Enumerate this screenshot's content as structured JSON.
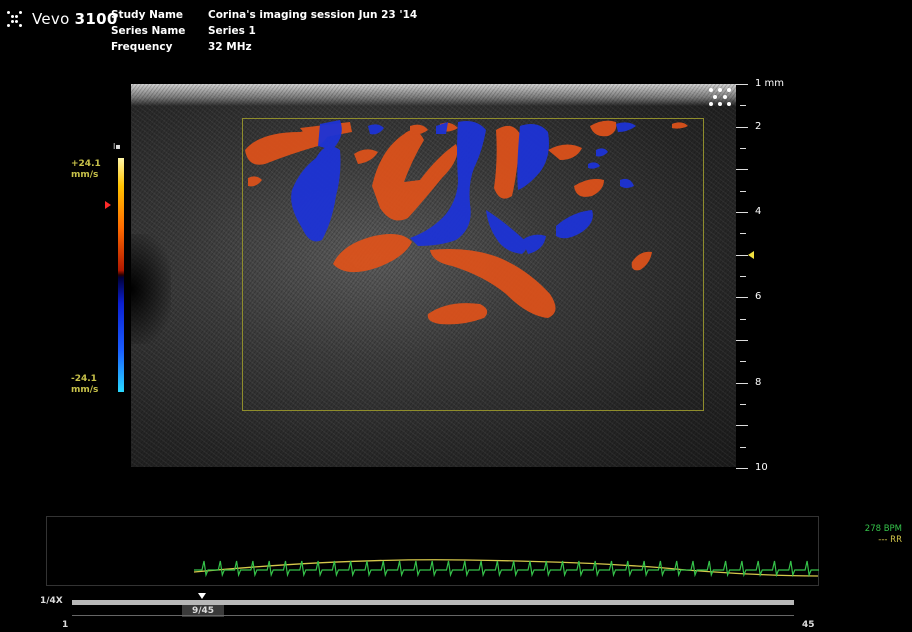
{
  "app": {
    "brand": "Vevo",
    "model": "3100"
  },
  "study": {
    "rows": [
      {
        "key": "Study Name",
        "value": "Corina's imaging session Jun 23 '14"
      },
      {
        "key": "Series Name",
        "value": "Series 1"
      },
      {
        "key": "Frequency",
        "value": "32 MHz"
      }
    ]
  },
  "color_scale": {
    "marker": "I▪",
    "max_value": "+24.1",
    "max_unit": "mm/s",
    "min_value": "-24.1",
    "min_unit": "mm/s",
    "positive_color": "#ff6a00",
    "negative_color": "#1a3dff"
  },
  "depth_scale": {
    "labels": [
      {
        "depth": 1,
        "label": "1 mm"
      },
      {
        "depth": 2,
        "label": "2"
      },
      {
        "depth": 4,
        "label": "4"
      },
      {
        "depth": 6,
        "label": "6"
      },
      {
        "depth": 8,
        "label": "8"
      },
      {
        "depth": 10,
        "label": "10"
      }
    ],
    "focus_depth": 5
  },
  "physio": {
    "heart_rate": "278 BPM",
    "resp_label": "--- RR",
    "ecg_color": "#35c24a",
    "resp_color": "#d6c84b"
  },
  "cine": {
    "speed": "1/4X",
    "current_frame_label": "9/45",
    "current_frame": 9,
    "total_frames": 45,
    "start_label": "1",
    "end_label": "45"
  }
}
